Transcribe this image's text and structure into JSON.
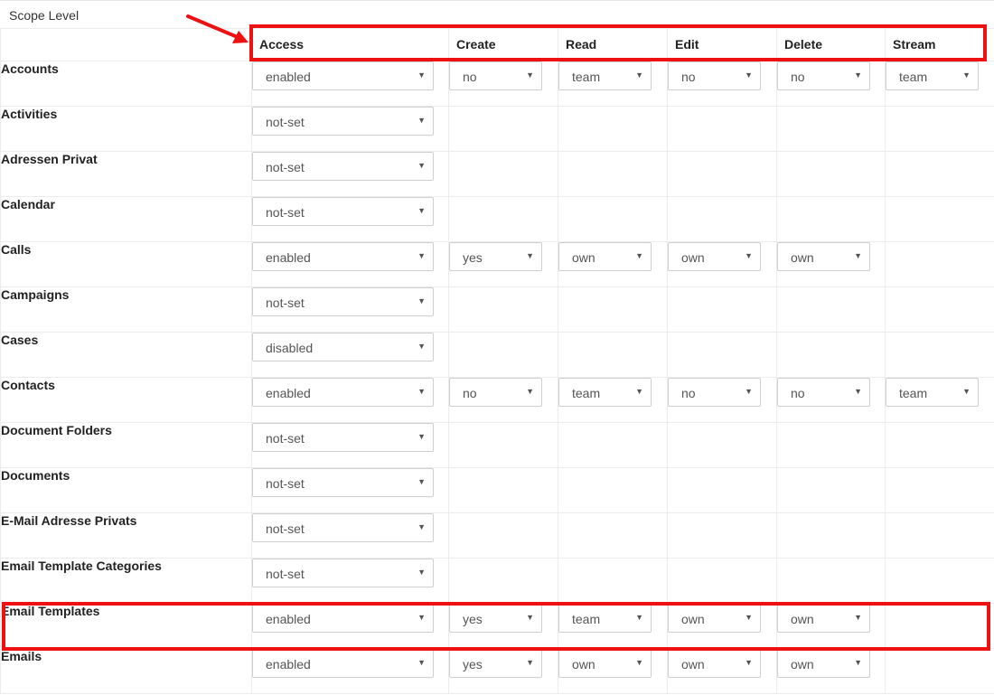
{
  "scope_label": "Scope Level",
  "columns": [
    "Access",
    "Create",
    "Read",
    "Edit",
    "Delete",
    "Stream"
  ],
  "rows": [
    {
      "name": "Accounts",
      "cells": [
        "enabled",
        "no",
        "team",
        "no",
        "no",
        "team"
      ],
      "row_style": "grid"
    },
    {
      "name": "Activities",
      "cells": [
        "not-set",
        null,
        null,
        null,
        null,
        null
      ],
      "row_style": "blank"
    },
    {
      "name": "Adressen Privat",
      "cells": [
        "not-set",
        null,
        null,
        null,
        null,
        null
      ],
      "row_style": "grid"
    },
    {
      "name": "Calendar",
      "cells": [
        "not-set",
        null,
        null,
        null,
        null,
        null
      ],
      "row_style": "blank"
    },
    {
      "name": "Calls",
      "cells": [
        "enabled",
        "yes",
        "own",
        "own",
        "own",
        null
      ],
      "row_style": "grid"
    },
    {
      "name": "Campaigns",
      "cells": [
        "not-set",
        null,
        null,
        null,
        null,
        null
      ],
      "row_style": "grid"
    },
    {
      "name": "Cases",
      "cells": [
        "disabled",
        null,
        null,
        null,
        null,
        null
      ],
      "row_style": "grid"
    },
    {
      "name": "Contacts",
      "cells": [
        "enabled",
        "no",
        "team",
        "no",
        "no",
        "team"
      ],
      "row_style": "grid"
    },
    {
      "name": "Document Folders",
      "cells": [
        "not-set",
        null,
        null,
        null,
        null,
        null
      ],
      "row_style": "grid"
    },
    {
      "name": "Documents",
      "cells": [
        "not-set",
        null,
        null,
        null,
        null,
        null
      ],
      "row_style": "grid"
    },
    {
      "name": "E-Mail Adresse Privats",
      "cells": [
        "not-set",
        null,
        null,
        null,
        null,
        null
      ],
      "row_style": "grid"
    },
    {
      "name": "Email Template Categories",
      "cells": [
        "not-set",
        null,
        null,
        null,
        null,
        null
      ],
      "row_style": "grid"
    },
    {
      "name": "Email Templates",
      "cells": [
        "enabled",
        "yes",
        "team",
        "own",
        "own",
        null
      ],
      "row_style": "grid"
    },
    {
      "name": "Emails",
      "cells": [
        "enabled",
        "yes",
        "own",
        "own",
        "own",
        null
      ],
      "row_style": "grid"
    }
  ],
  "caret_glyph": "▼",
  "annotation_color": "#ee1111"
}
